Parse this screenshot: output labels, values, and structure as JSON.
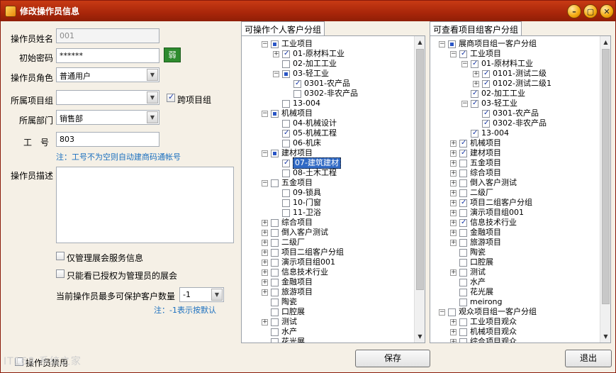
{
  "window": {
    "title": "修改操作员信息",
    "min": "–",
    "max": "▢",
    "close": "✕"
  },
  "form": {
    "name_label": "操作员姓名",
    "name_value": "001",
    "pwd_label": "初始密码",
    "pwd_value": "******",
    "pwd_strength": "弱",
    "role_label": "操作员角色",
    "role_value": "普通用户",
    "group_label": "所属项目组",
    "group_value": "",
    "cross_group_label": "跨项目组",
    "cross_group_checked": true,
    "dept_label": "所属部门",
    "dept_value": "销售部",
    "emp_label": "工　号",
    "emp_value": "803",
    "emp_note": "注：工号不为空则自动建商码通帐号",
    "desc_label": "操作员描述",
    "desc_value": "",
    "only_manage_label": "仅管理展会服务信息",
    "only_view_label": "只能看已授权为管理员的展会",
    "max_label": "当前操作员最多可保护客户数量",
    "max_value": "-1",
    "max_note": "注：-1表示按默认"
  },
  "left_panel": {
    "tab": "可操作个人客户分组",
    "rows": [
      {
        "exp": "-",
        "cb": "partial",
        "text": "工业项目",
        "lvl": 1
      },
      {
        "exp": "+",
        "cb": "checked",
        "text": "01-原材料工业",
        "lvl": 2
      },
      {
        "exp": "",
        "cb": "",
        "text": "02-加工工业",
        "lvl": 2
      },
      {
        "exp": "-",
        "cb": "partial",
        "text": "03-轻工业",
        "lvl": 2
      },
      {
        "exp": "",
        "cb": "checked",
        "text": "0301-农产品",
        "lvl": 3
      },
      {
        "exp": "",
        "cb": "",
        "text": "0302-非农产品",
        "lvl": 3
      },
      {
        "exp": "",
        "cb": "",
        "text": "13-004",
        "lvl": 2
      },
      {
        "exp": "-",
        "cb": "partial",
        "text": "机械项目",
        "lvl": 1
      },
      {
        "exp": "",
        "cb": "",
        "text": "04-机械设计",
        "lvl": 2
      },
      {
        "exp": "",
        "cb": "checked",
        "text": "05-机械工程",
        "lvl": 2
      },
      {
        "exp": "",
        "cb": "",
        "text": "06-机床",
        "lvl": 2
      },
      {
        "exp": "-",
        "cb": "partial",
        "text": "建材项目",
        "lvl": 1
      },
      {
        "exp": "",
        "cb": "checked",
        "text": "07-建筑建材",
        "lvl": 2,
        "sel": true
      },
      {
        "exp": "",
        "cb": "",
        "text": "08-土木工程",
        "lvl": 2
      },
      {
        "exp": "-",
        "cb": "",
        "text": "五金项目",
        "lvl": 1
      },
      {
        "exp": "",
        "cb": "",
        "text": "09-锁具",
        "lvl": 2
      },
      {
        "exp": "",
        "cb": "",
        "text": "10-门窗",
        "lvl": 2
      },
      {
        "exp": "",
        "cb": "",
        "text": "11-卫浴",
        "lvl": 2
      },
      {
        "exp": "+",
        "cb": "",
        "text": "综合项目",
        "lvl": 1
      },
      {
        "exp": "+",
        "cb": "",
        "text": "倒入客户测试",
        "lvl": 1
      },
      {
        "exp": "+",
        "cb": "",
        "text": "二级厂",
        "lvl": 1
      },
      {
        "exp": "+",
        "cb": "",
        "text": "项目二组客户分组",
        "lvl": 1
      },
      {
        "exp": "+",
        "cb": "",
        "text": "演示项目组001",
        "lvl": 1
      },
      {
        "exp": "+",
        "cb": "",
        "text": "信息技术行业",
        "lvl": 1
      },
      {
        "exp": "+",
        "cb": "",
        "text": "金融项目",
        "lvl": 1
      },
      {
        "exp": "+",
        "cb": "",
        "text": "旅游项目",
        "lvl": 1
      },
      {
        "exp": "",
        "cb": "",
        "text": "陶瓷",
        "lvl": 1
      },
      {
        "exp": "",
        "cb": "",
        "text": "口腔展",
        "lvl": 1
      },
      {
        "exp": "+",
        "cb": "",
        "text": "测试",
        "lvl": 1
      },
      {
        "exp": "",
        "cb": "",
        "text": "水产",
        "lvl": 1
      },
      {
        "exp": "",
        "cb": "",
        "text": "花光展",
        "lvl": 1
      }
    ]
  },
  "right_panel": {
    "tab": "可查看项目组客户分组",
    "rows": [
      {
        "exp": "-",
        "cb": "partial",
        "text": "展商项目组一客户分组",
        "lvl": 0
      },
      {
        "exp": "-",
        "cb": "checked",
        "text": "工业项目",
        "lvl": 1
      },
      {
        "exp": "-",
        "cb": "checked",
        "text": "01-原材料工业",
        "lvl": 2
      },
      {
        "exp": "+",
        "cb": "checked",
        "text": "0101-测试二级",
        "lvl": 3
      },
      {
        "exp": "+",
        "cb": "checked",
        "text": "0102-测试二级1",
        "lvl": 3
      },
      {
        "exp": "",
        "cb": "checked",
        "text": "02-加工工业",
        "lvl": 2
      },
      {
        "exp": "-",
        "cb": "checked",
        "text": "03-轻工业",
        "lvl": 2
      },
      {
        "exp": "",
        "cb": "checked",
        "text": "0301-农产品",
        "lvl": 3
      },
      {
        "exp": "",
        "cb": "checked",
        "text": "0302-非农产品",
        "lvl": 3
      },
      {
        "exp": "",
        "cb": "checked",
        "text": "13-004",
        "lvl": 2
      },
      {
        "exp": "+",
        "cb": "checked",
        "text": "机械项目",
        "lvl": 1
      },
      {
        "exp": "+",
        "cb": "checked",
        "text": "建材项目",
        "lvl": 1
      },
      {
        "exp": "+",
        "cb": "",
        "text": "五金项目",
        "lvl": 1
      },
      {
        "exp": "+",
        "cb": "",
        "text": "综合项目",
        "lvl": 1
      },
      {
        "exp": "+",
        "cb": "",
        "text": "倒入客户测试",
        "lvl": 1
      },
      {
        "exp": "+",
        "cb": "",
        "text": "二级厂",
        "lvl": 1
      },
      {
        "exp": "+",
        "cb": "checked",
        "text": "项目二组客户分组",
        "lvl": 1
      },
      {
        "exp": "+",
        "cb": "",
        "text": "演示项目组001",
        "lvl": 1
      },
      {
        "exp": "+",
        "cb": "checked",
        "text": "信息技术行业",
        "lvl": 1
      },
      {
        "exp": "+",
        "cb": "",
        "text": "金融项目",
        "lvl": 1
      },
      {
        "exp": "+",
        "cb": "",
        "text": "旅游项目",
        "lvl": 1
      },
      {
        "exp": "",
        "cb": "",
        "text": "陶瓷",
        "lvl": 1
      },
      {
        "exp": "",
        "cb": "",
        "text": "口腔展",
        "lvl": 1
      },
      {
        "exp": "+",
        "cb": "",
        "text": "测试",
        "lvl": 1
      },
      {
        "exp": "",
        "cb": "",
        "text": "水产",
        "lvl": 1
      },
      {
        "exp": "",
        "cb": "",
        "text": "花光展",
        "lvl": 1
      },
      {
        "exp": "",
        "cb": "",
        "text": "meirong",
        "lvl": 1
      },
      {
        "exp": "-",
        "cb": "",
        "text": "观众项目组一客户分组",
        "lvl": 0
      },
      {
        "exp": "+",
        "cb": "",
        "text": "工业项目观众",
        "lvl": 1
      },
      {
        "exp": "+",
        "cb": "",
        "text": "机械项目观众",
        "lvl": 1
      },
      {
        "exp": "+",
        "cb": "",
        "text": "综合项目观众",
        "lvl": 1
      }
    ]
  },
  "footer": {
    "disable_label": "操作员禁用",
    "save_label": "保存",
    "exit_label": "退出",
    "watermark": "IT168 系统之家"
  }
}
